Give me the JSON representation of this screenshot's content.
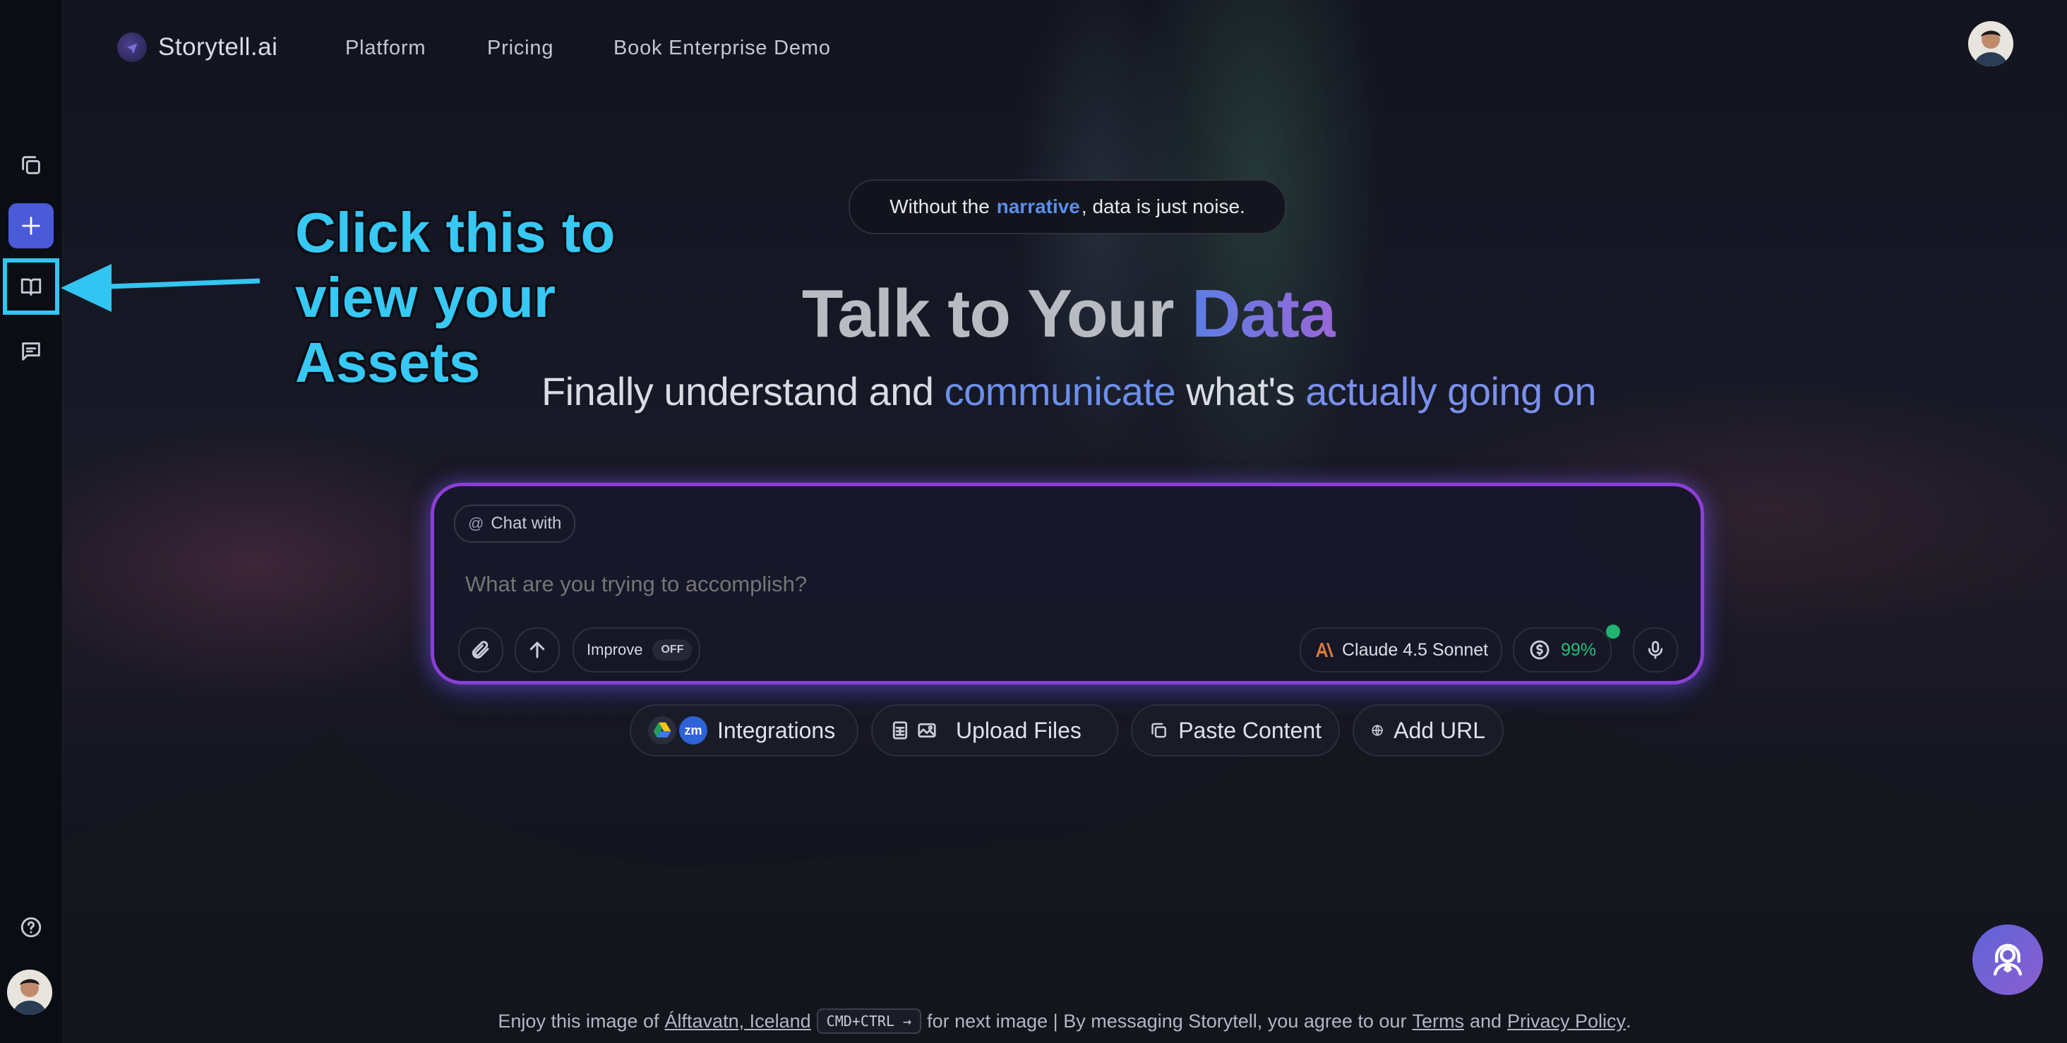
{
  "header": {
    "brand": "Storytell.ai",
    "nav": [
      "Platform",
      "Pricing",
      "Book Enterprise Demo"
    ]
  },
  "tagline": {
    "prefix": "Without the ",
    "highlight": "narrative",
    "suffix": ", data is just noise."
  },
  "hero": {
    "title_plain": "Talk to Your ",
    "title_accent": "Data",
    "subtitle_1": "Finally understand and ",
    "subtitle_2": "communicate",
    "subtitle_3": " what's ",
    "subtitle_4": "actually going on"
  },
  "annotation": {
    "text": "Click this to view your Assets"
  },
  "chat": {
    "chat_with_label": "Chat with",
    "placeholder": "What are you trying to accomplish?",
    "improve_label": "Improve",
    "improve_state": "OFF",
    "model": "Claude 4.5 Sonnet",
    "credits": "99%"
  },
  "actions": {
    "integrations": "Integrations",
    "integrations_badge": "zm",
    "upload": "Upload Files",
    "paste": "Paste Content",
    "add_url": "Add URL"
  },
  "footer": {
    "prefix": "Enjoy this image of",
    "location": "Álftavatn, Iceland",
    "shortcut": "CMD+CTRL →",
    "middle": "for next image | By messaging Storytell, you agree to our",
    "terms": "Terms",
    "and": "and",
    "privacy": "Privacy Policy",
    "period": "."
  },
  "colors": {
    "accent": "#4a5ad8",
    "annotation": "#33c5f1",
    "chat_border": "#8a3fd6",
    "credits": "#22c07a"
  }
}
